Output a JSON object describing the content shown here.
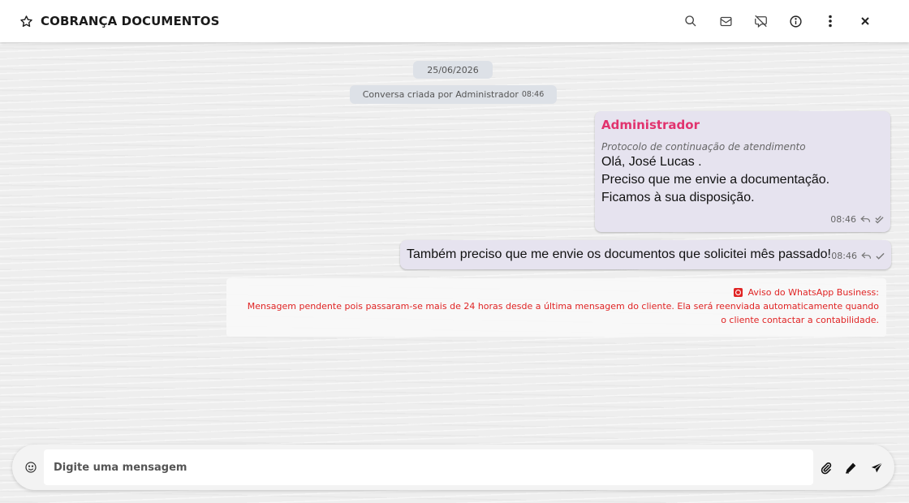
{
  "header": {
    "title": "COBRANÇA DOCUMENTOS",
    "icons": [
      "star-icon",
      "search-icon",
      "mail-icon",
      "comment-off-icon",
      "info-icon",
      "more-vertical-icon",
      "close-icon"
    ]
  },
  "conversation": {
    "date": "25/06/2026",
    "system_message": {
      "text": "Conversa criada por Administrador",
      "time": "08:46"
    },
    "messages": [
      {
        "sender": "Administrador",
        "protocol": "Protocolo de continuação de atendimento",
        "lines": [
          "Olá, José Lucas .",
          "Preciso que me envie a documentação.",
          "",
          "Ficamos à sua disposição."
        ],
        "time": "08:46",
        "status": "double-check"
      },
      {
        "text": "Também preciso que me envie os documentos que solicitei mês passado!",
        "time": "08:46",
        "status": "single-check"
      }
    ],
    "warning": {
      "title": "Aviso do WhatsApp Business:",
      "text": "Mensagem pendente pois passaram-se mais de 24 horas desde a última mensagem do cliente. Ela será reenviada automaticamente quando o cliente contactar a contabilidade."
    }
  },
  "composer": {
    "placeholder": "Digite uma mensagem",
    "value": ""
  },
  "colors": {
    "sender": "#e1336e",
    "bubble": "#e6e3ef",
    "warning": "#e02424",
    "chip": "#dde1e7"
  }
}
